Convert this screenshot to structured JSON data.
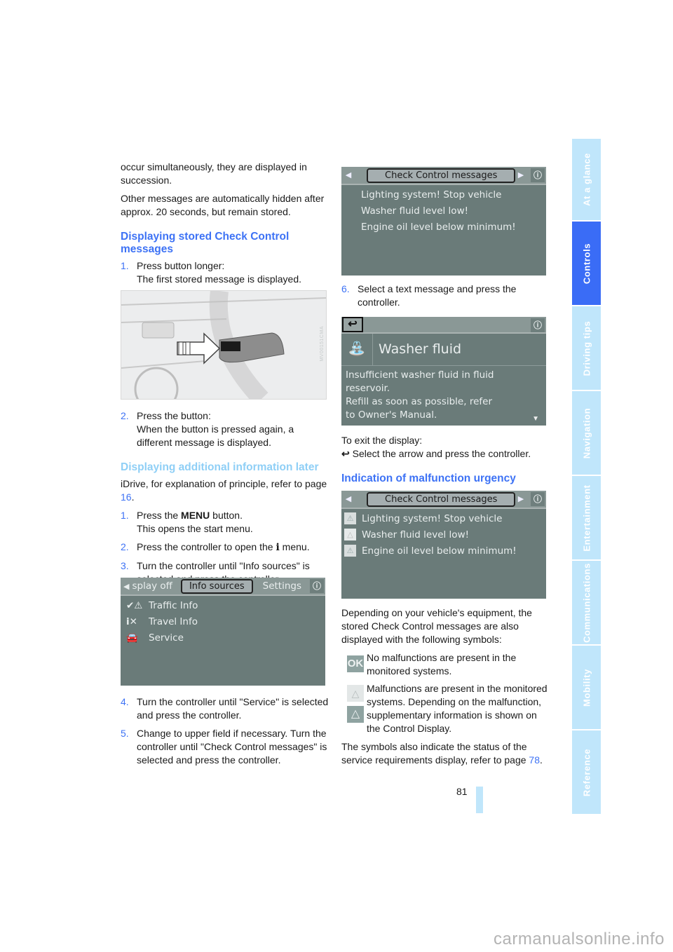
{
  "sidebar": {
    "tabs": [
      {
        "label": "At a glance",
        "active": false
      },
      {
        "label": "Controls",
        "active": true
      },
      {
        "label": "Driving tips",
        "active": false
      },
      {
        "label": "Navigation",
        "active": false
      },
      {
        "label": "Entertainment",
        "active": false
      },
      {
        "label": "Communications",
        "active": false
      },
      {
        "label": "Mobility",
        "active": false
      },
      {
        "label": "Reference",
        "active": false
      }
    ]
  },
  "left": {
    "intro_p1": "occur simultaneously, they are displayed in succession.",
    "intro_p2": "Other messages are automatically hidden after approx. 20 seconds, but remain stored.",
    "section1": {
      "heading": "Displaying stored Check Control messages",
      "step1_num": "1.",
      "step1_a": "Press button longer:",
      "step1_b": "The first stored message is displayed.",
      "figure_label": "MV00151CMA",
      "step2_num": "2.",
      "step2_a": "Press the button:",
      "step2_b": "When the button is pressed again, a different message is displayed."
    },
    "section2": {
      "heading": "Displaying additional information later",
      "intro_a": "iDrive, for explanation of principle, refer to page ",
      "intro_link": "16",
      "intro_b": ".",
      "steps": [
        {
          "num": "1.",
          "pre": "Press the ",
          "bold": "MENU",
          "post": " button.",
          "sub": "This opens the start menu."
        },
        {
          "num": "2.",
          "text": "Press the controller to open the ",
          "icon": "i",
          "post": " menu."
        },
        {
          "num": "3.",
          "text": "Turn the controller until \"Info sources\" is selected and press the controller."
        },
        {
          "num": "4.",
          "text": "Turn the controller until \"Service\" is selected and press the controller."
        },
        {
          "num": "5.",
          "text": "Change to upper field if necessary. Turn the controller until \"Check Control messages\" is selected and press the controller."
        }
      ],
      "screen": {
        "tab_prev": "splay off",
        "tab_selected": "Info sources",
        "tab_next": "Settings",
        "items": [
          "Traffic Info",
          "Travel Info",
          "Service"
        ]
      }
    }
  },
  "right": {
    "screen1": {
      "title": "Check Control messages",
      "messages": [
        "Lighting system! Stop vehicle",
        "Washer fluid level low!",
        "Engine oil level below minimum!"
      ]
    },
    "step6_num": "6.",
    "step6": "Select a text message and press the controller.",
    "screen2": {
      "title": "Washer fluid",
      "body": [
        "Insufficient washer fluid in fluid",
        "reservoir.",
        "Refill as soon as possible, refer",
        "to Owner's Manual."
      ]
    },
    "exit_label": "To exit the display:",
    "exit_text": "Select the arrow and press the controller.",
    "section3": {
      "heading": "Indication of malfunction urgency",
      "screen": {
        "title": "Check Control messages",
        "messages": [
          "Lighting system! Stop vehicle",
          "Washer fluid level low!",
          "Engine oil level below minimum!"
        ]
      },
      "para": "Depending on your vehicle's equipment, the stored Check Control messages are also displayed with the following symbols:",
      "sym_ok_label": "OK",
      "sym_ok_text": "No malfunctions are present in the monitored systems.",
      "sym_warn_text": "Malfunctions are present in the monitored systems. Depending on the malfunction, supplementary information is shown on the Control Display.",
      "final_a": "The symbols also indicate the status of the service requirements display, refer to page ",
      "final_link": "78",
      "final_b": "."
    }
  },
  "page_number": "81",
  "footer_watermark": "carmanualsonline.info"
}
